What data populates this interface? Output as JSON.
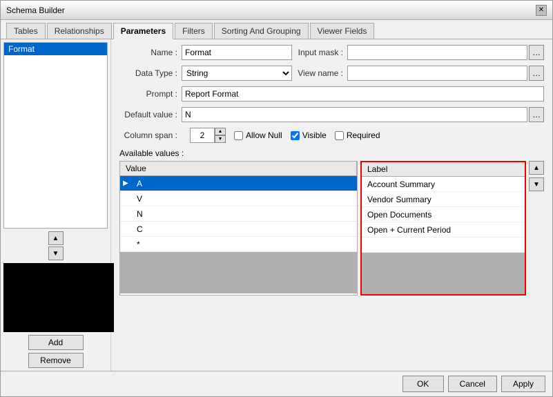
{
  "window": {
    "title": "Schema Builder"
  },
  "tabs": [
    {
      "id": "tables",
      "label": "Tables",
      "active": false
    },
    {
      "id": "relationships",
      "label": "Relationships",
      "active": false
    },
    {
      "id": "parameters",
      "label": "Parameters",
      "active": true
    },
    {
      "id": "filters",
      "label": "Filters",
      "active": false
    },
    {
      "id": "sorting",
      "label": "Sorting And Grouping",
      "active": false
    },
    {
      "id": "viewer",
      "label": "Viewer Fields",
      "active": false
    }
  ],
  "left_panel": {
    "items": [
      {
        "id": "format",
        "label": "Format",
        "selected": true
      }
    ],
    "add_label": "Add",
    "remove_label": "Remove"
  },
  "form": {
    "name_label": "Name :",
    "name_value": "Format",
    "input_mask_label": "Input mask :",
    "input_mask_value": "",
    "data_type_label": "Data Type :",
    "data_type_value": "String",
    "view_name_label": "View name :",
    "view_name_value": "",
    "prompt_label": "Prompt :",
    "prompt_value": "Report Format",
    "default_value_label": "Default value :",
    "default_value": "N",
    "column_span_label": "Column span :",
    "column_span_value": "2",
    "allow_null_label": "Allow Null",
    "visible_label": "Visible",
    "required_label": "Required",
    "allow_null_checked": false,
    "visible_checked": true,
    "required_checked": false
  },
  "available_values": {
    "section_label": "Available values :",
    "value_column": "Value",
    "label_column": "Label",
    "rows": [
      {
        "value": "A",
        "selected": true
      },
      {
        "value": "V",
        "selected": false
      },
      {
        "value": "N",
        "selected": false
      },
      {
        "value": "C",
        "selected": false
      },
      {
        "value": "*",
        "selected": false
      }
    ],
    "label_rows": [
      {
        "label": "Account Summary",
        "selected": false
      },
      {
        "label": "Vendor Summary",
        "selected": false
      },
      {
        "label": "Open Documents",
        "selected": false
      },
      {
        "label": "Open + Current Period",
        "selected": false
      },
      {
        "label": "",
        "selected": false
      }
    ]
  },
  "footer": {
    "ok_label": "OK",
    "cancel_label": "Cancel",
    "apply_label": "Apply"
  }
}
